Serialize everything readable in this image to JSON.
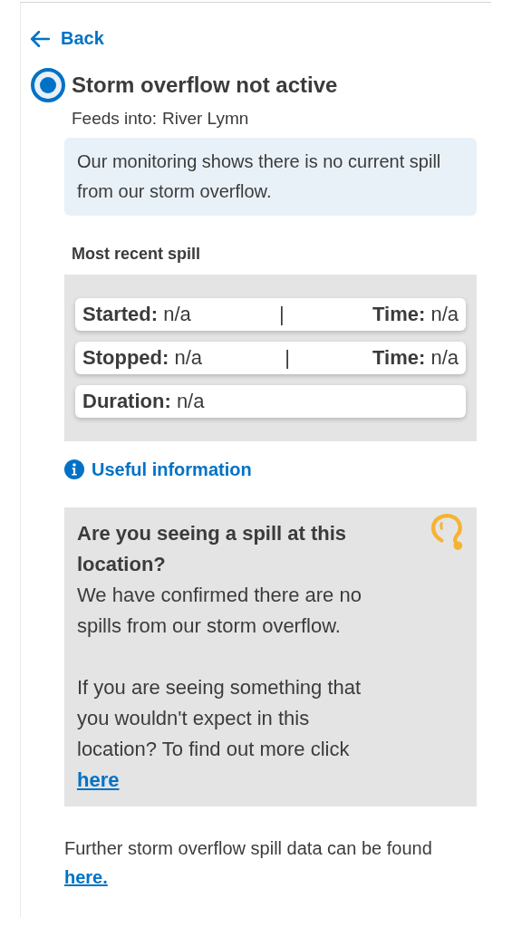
{
  "back_link": "Back",
  "status": {
    "title": "Storm overflow not active",
    "feeds_into_label": "Feeds into:",
    "feeds_into_value": "River Lymn",
    "message": "Our monitoring shows there is no current spill from our storm overflow."
  },
  "most_recent_spill": {
    "heading": "Most recent spill",
    "rows": [
      {
        "fields": [
          {
            "label": "Started:",
            "value": "n/a"
          },
          {
            "label": "Time:",
            "value": "n/a"
          }
        ],
        "separator": "|"
      },
      {
        "fields": [
          {
            "label": "Stopped:",
            "value": "n/a"
          },
          {
            "label": "Time:",
            "value": "n/a"
          }
        ],
        "separator": "|"
      },
      {
        "fields": [
          {
            "label": "Duration:",
            "value": "n/a"
          }
        ]
      }
    ]
  },
  "useful_information_link": "Useful information",
  "spill_report": {
    "heading": "Are you seeing a spill at this location?",
    "paragraphs": [
      "We have confirmed there are no spills from our storm overflow.",
      "If you are seeing something that you wouldn't expect in this location? To find out more click"
    ],
    "link": "here"
  },
  "footer": {
    "text": "Further storm overflow spill data can be found",
    "link": "here."
  }
}
